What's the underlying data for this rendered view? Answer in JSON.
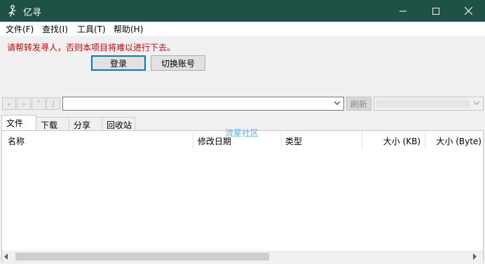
{
  "window": {
    "title": "亿寻",
    "app_icon": "yixun-icon",
    "controls": [
      "minimize-icon",
      "maximize-icon",
      "close-icon"
    ]
  },
  "menu": [
    "文件(F)",
    "查找(I)",
    "工具(T)",
    "帮助(H)"
  ],
  "login": {
    "warning": "请帮转发寻人，否则本项目将难以进行下去。",
    "login_button": "登录",
    "switch_button": "切换账号"
  },
  "toolbar": {
    "back": "‹",
    "forward": "›",
    "up": "˄",
    "root": "/",
    "address_value": "",
    "refresh": "刷新",
    "filter_value": ""
  },
  "tabs": [
    "文件",
    "下载",
    "分享",
    "回收站"
  ],
  "list": {
    "columns": [
      "名称",
      "修改日期",
      "类型",
      "大小 (KB)",
      "大小 (Byte)"
    ],
    "rows": []
  },
  "watermark": "流星社区",
  "colors": {
    "titlebar": "#1f5247",
    "warning_text": "#e00000",
    "accent": "#0078d7"
  }
}
